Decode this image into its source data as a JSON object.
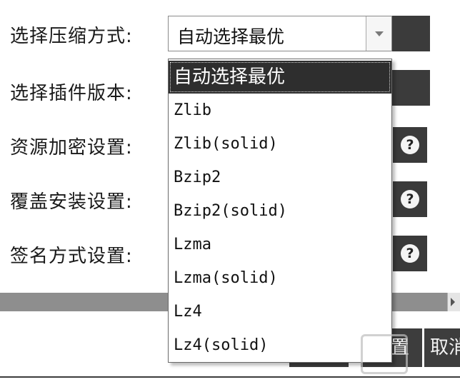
{
  "form": {
    "compression_label": "选择压缩方式:",
    "plugin_label": "选择插件版本:",
    "encrypt_label": "资源加密设置:",
    "overwrite_label": "覆盖安装设置:",
    "sign_label": "签名方式设置:"
  },
  "compression_select": {
    "value": "自动选择最优",
    "options": [
      "自动选择最优",
      "Zlib",
      "Zlib(solid)",
      "Bzip2",
      "Bzip2(solid)",
      "Lzma",
      "Lzma(solid)",
      "Lz4",
      "Lz4(solid)"
    ],
    "selected_index": 0
  },
  "help": {
    "glyph": "?"
  },
  "buttons": {
    "confirm_partial": "置",
    "cancel_partial": "取消"
  },
  "icons": {
    "dropdown": "chevron-down-icon",
    "help": "question-circle-icon",
    "scroll": "scroll-right-icon"
  },
  "colors": {
    "dark_panel": "#3b3b3b",
    "selected_option_bg": "#2e2e2e",
    "separator": "#8e8e8e"
  }
}
